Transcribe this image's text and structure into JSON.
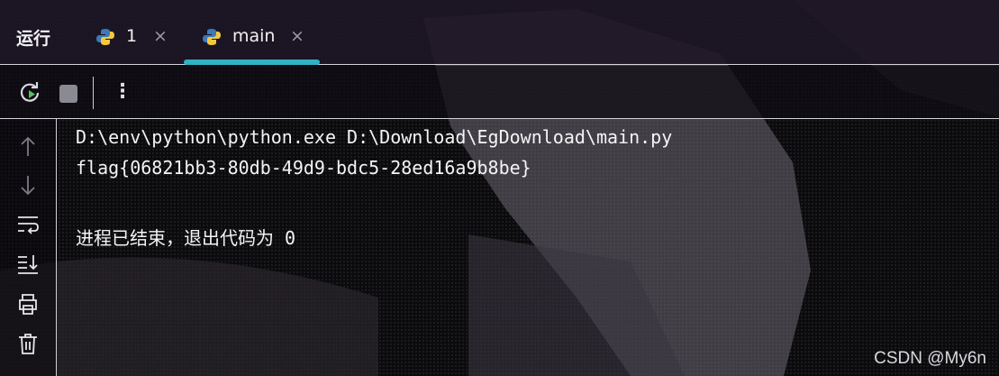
{
  "panel": {
    "title": "运行"
  },
  "tabs": [
    {
      "label": "1",
      "close": "×",
      "icon": "python-icon"
    },
    {
      "label": "main",
      "close": "×",
      "icon": "python-icon",
      "active": true
    }
  ],
  "toolbar": {
    "more": "⋮"
  },
  "console": {
    "lines": [
      "D:\\env\\python\\python.exe D:\\Download\\EgDownload\\main.py",
      "flag{06821bb3-80db-49d9-bdc5-28ed16a9b8be}",
      "进程已结束，退出代码为 0"
    ]
  },
  "watermark": "CSDN @My6n",
  "colors": {
    "accent": "#2fb3c4",
    "text": "#f4f4f4",
    "border": "#d7d5dc",
    "rerun_green": "#57c35b"
  }
}
